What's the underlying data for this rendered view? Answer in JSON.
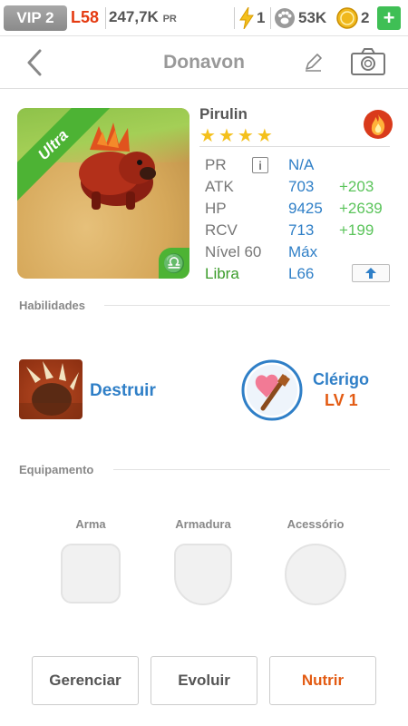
{
  "status_bar": {
    "vip": "VIP 2",
    "level": "L58",
    "power_value": "247,7K",
    "power_unit": "PR",
    "energy": "1",
    "paws": "53K",
    "coins": "2",
    "add_label": "+",
    "icons": {
      "energy": "lightning-icon",
      "paws": "paw-icon",
      "coins": "coin-icon"
    }
  },
  "header": {
    "title": "Donavon",
    "icons": {
      "back": "back-arrow-icon",
      "edit": "pencil-icon",
      "camera": "camera-icon"
    }
  },
  "creature": {
    "name": "Pirulin",
    "stars": 4,
    "rarity": "Ultra",
    "element_icon": "fire-icon",
    "zodiac_symbol": "♎",
    "stats": {
      "pr_label": "PR",
      "pr_info": "i",
      "pr_value": "N/A",
      "atk_label": "ATK",
      "atk_value": "703",
      "atk_bonus": "+203",
      "hp_label": "HP",
      "hp_value": "9425",
      "hp_bonus": "+2639",
      "rcv_label": "RCV",
      "rcv_value": "713",
      "rcv_bonus": "+199",
      "level_label": "Nível 60",
      "level_value": "Máx",
      "sign_label": "Libra",
      "sign_value": "L66"
    }
  },
  "skills": {
    "heading": "Habilidades",
    "active": {
      "name": "Destruir",
      "icon": "claw-icon"
    },
    "passive": {
      "name": "Clérigo",
      "level": "LV 1",
      "icon": "heart-staff-icon"
    }
  },
  "equipment": {
    "heading": "Equipamento",
    "slots": [
      "Arma",
      "Armadura",
      "Acessório"
    ]
  },
  "actions": {
    "manage": "Gerenciar",
    "evolve": "Evoluir",
    "feed": "Nutrir"
  },
  "colors": {
    "level_red": "#e53b12",
    "stat_blue": "#2f7fc7",
    "bonus_green": "#5bc45b",
    "rarity_green": "#4db334",
    "feed_orange": "#e35b13",
    "star_gold": "#f4c01c"
  }
}
